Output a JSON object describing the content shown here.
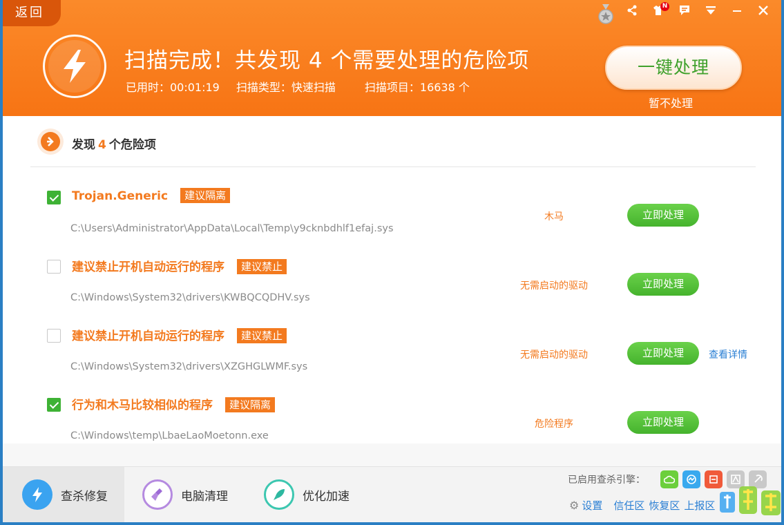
{
  "header": {
    "back_label": "返回",
    "title": "扫描完成！共发现 4 个需要处理的危险项",
    "elapsed": "已用时：00:01:19",
    "scan_type": "扫描类型：快速扫描",
    "scan_items": "扫描项目：16638 个",
    "one_key_label": "一键处理",
    "skip_label": "暂不处理"
  },
  "summary": {
    "prefix": "发现",
    "count": "4",
    "suffix": "个危险项"
  },
  "items": [
    {
      "name": "Trojan.Generic",
      "tag": "建议隔离",
      "path": "C:\\Users\\Administrator\\AppData\\Local\\Temp\\y9cknbdhlf1efaj.sys",
      "type": "木马",
      "button": "立即处理",
      "checked": true
    },
    {
      "name": "建议禁止开机自动运行的程序",
      "tag": "建议禁止",
      "path": "C:\\Windows\\System32\\drivers\\KWBQCQDHV.sys",
      "type": "无需启动的驱动",
      "button": "立即处理",
      "checked": false
    },
    {
      "name": "建议禁止开机自动运行的程序",
      "tag": "建议禁止",
      "path": "C:\\Windows\\System32\\drivers\\XZGHGLWMF.sys",
      "type": "无需启动的驱动",
      "button": "立即处理",
      "detail": "查看详情",
      "checked": false
    },
    {
      "name": "行为和木马比较相似的程序",
      "tag": "建议隔离",
      "path": "C:\\Windows\\temp\\LbaeLaoMoetonn.exe",
      "type": "危险程序",
      "button": "立即处理",
      "checked": true
    }
  ],
  "footer": {
    "tabs": [
      {
        "label": "查杀修复",
        "icon": "bolt-icon"
      },
      {
        "label": "电脑清理",
        "icon": "broom-icon"
      },
      {
        "label": "优化加速",
        "icon": "rocket-icon"
      }
    ],
    "engines_label": "已启用查杀引擎：",
    "links": {
      "settings": "设置",
      "trust": "信任区",
      "restore": "恢复区",
      "upload": "上报区"
    }
  },
  "colors": {
    "brand_orange": "#f77414",
    "accent_green": "#45b32d",
    "link_blue": "#2a7fd4"
  }
}
